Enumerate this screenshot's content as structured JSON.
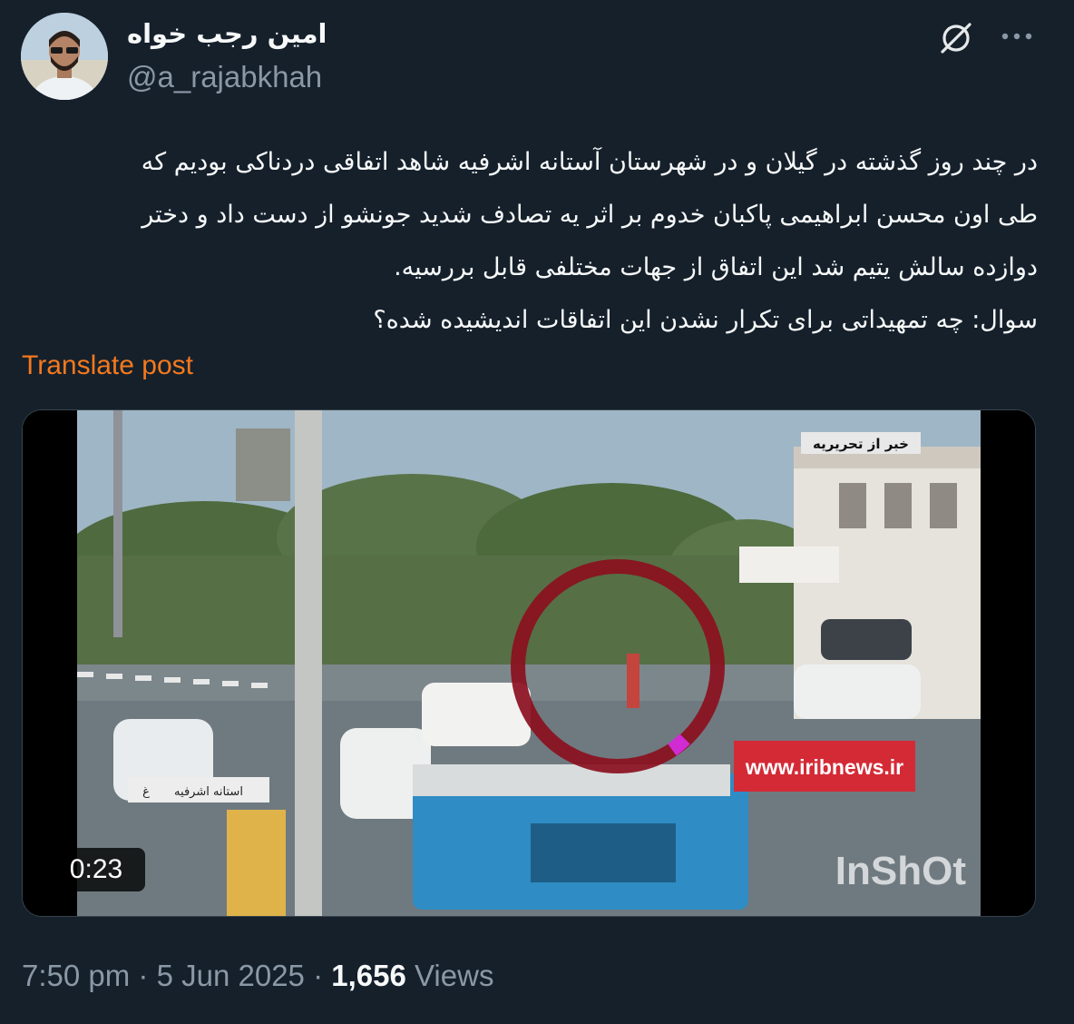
{
  "author": {
    "display_name": "امین رجب خواه",
    "handle": "@a_rajabkhah"
  },
  "header_icons": {
    "grok": "grok-icon",
    "more": "more-icon"
  },
  "post": {
    "text": "در چند روز گذشته در گیلان و در شهرستان آستانه اشرفیه شاهد اتفاقی دردناکی بودیم که\nطی اون محسن ابراهیمی پاکبان خدوم بر اثر یه تصادف شدید جونشو از دست داد و دختر\nدوازده سالش یتیم شد این اتفاق از جهات مختلفی قابل بررسیه.\nسوال: چه تمهیداتی برای تکرار نشدن این اتفاقات اندیشیده شده؟",
    "translate_label": "Translate post"
  },
  "video": {
    "duration": "0:23",
    "overlay_top_label": "خبر از تحریریه",
    "overlay_site": "www.iribnews.ir",
    "overlay_location": "استانه اشرفیه",
    "overlay_location_tag": "غ",
    "watermark": "InShOt"
  },
  "meta": {
    "time": "7:50 pm",
    "separator": "·",
    "date": "5 Jun 2025",
    "views_count": "1,656",
    "views_label": "Views"
  },
  "colors": {
    "background": "#15202b",
    "text_primary": "#f7f9f9",
    "text_secondary": "#8b98a5",
    "translate_link": "#f4791e",
    "circle_marker": "#8b0f1e",
    "site_banner": "#d42a36"
  }
}
